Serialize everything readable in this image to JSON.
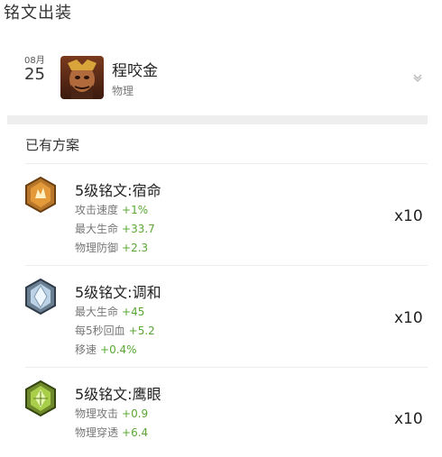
{
  "page": {
    "title": "铭文出装"
  },
  "hero": {
    "month": "08月",
    "day": "25",
    "name": "程咬金",
    "type": "物理"
  },
  "section": {
    "title": "已有方案"
  },
  "runes": [
    {
      "name": "5级铭文:宿命",
      "count": "x10",
      "icon": "rune-orange-icon",
      "stats": [
        {
          "label": "攻击速度",
          "value": "+1%"
        },
        {
          "label": "最大生命",
          "value": "+33.7"
        },
        {
          "label": "物理防御",
          "value": "+2.3"
        }
      ]
    },
    {
      "name": "5级铭文:调和",
      "count": "x10",
      "icon": "rune-blue-icon",
      "stats": [
        {
          "label": "最大生命",
          "value": "+45"
        },
        {
          "label": "每5秒回血",
          "value": "+5.2"
        },
        {
          "label": "移速",
          "value": "+0.4%"
        }
      ]
    },
    {
      "name": "5级铭文:鹰眼",
      "count": "x10",
      "icon": "rune-green-icon",
      "stats": [
        {
          "label": "物理攻击",
          "value": "+0.9"
        },
        {
          "label": "物理穿透",
          "value": "+6.4"
        }
      ]
    }
  ],
  "colors": {
    "stat_value": "#5aa833",
    "label": "#777777"
  }
}
